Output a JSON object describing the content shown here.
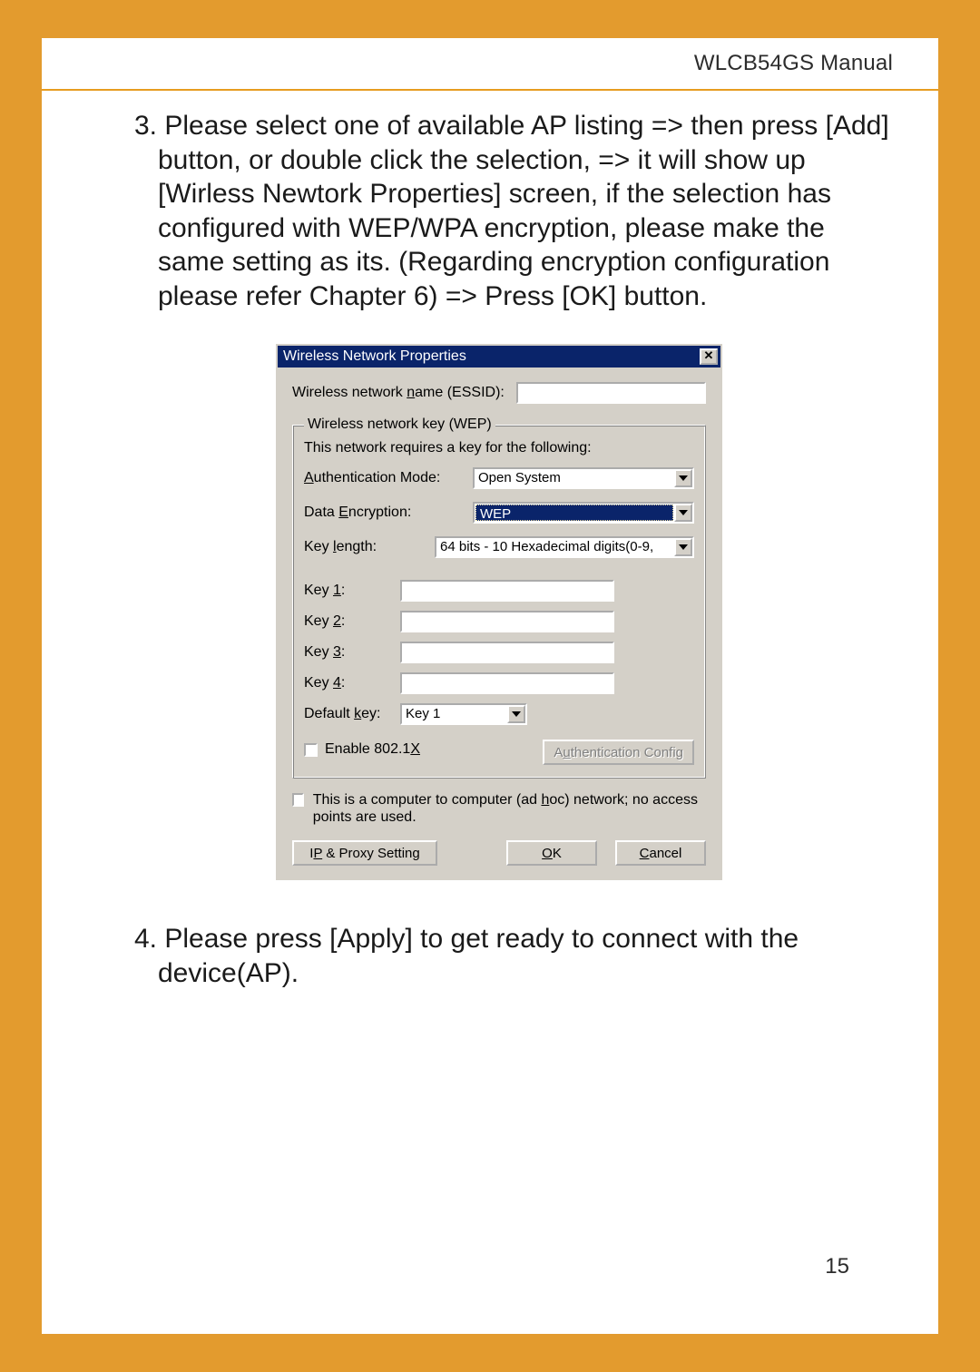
{
  "header": {
    "manual_title": "WLCB54GS Manual"
  },
  "paragraphs": {
    "p3_num": "3. ",
    "p3_text": "Please select one of available AP listing => then press [Add] button, or double click the selection, => it will show up [Wirless Newtork Properties] screen, if the selection has configured with WEP/WPA encryption, please make the same setting as its. (Regarding encryption configuration please refer Chapter 6) => Press [OK] button.",
    "p4_num": "4. ",
    "p4_text": "Please press [Apply] to get ready to connect with the device(AP)."
  },
  "dialog": {
    "title": "Wireless Network Properties",
    "essid_label_pre": "Wireless network ",
    "essid_label_u": "n",
    "essid_label_post": "ame (ESSID):",
    "essid_value": "",
    "wep_legend": "Wireless network key (WEP)",
    "wep_intro": "This network requires a key for the following:",
    "auth_label_pre": "",
    "auth_label_u": "A",
    "auth_label_post": "uthentication Mode:",
    "auth_value": "Open System",
    "enc_label_pre": "Data ",
    "enc_label_u": "E",
    "enc_label_post": "ncryption:",
    "enc_value": "WEP",
    "keylen_label_pre": "Key ",
    "keylen_label_u": "l",
    "keylen_label_post": "ength:",
    "keylen_value": "64 bits - 10 Hexadecimal digits(0-9,",
    "key1_label_pre": "Key ",
    "key1_label_u": "1",
    "key1_label_post": ":",
    "key2_label_pre": "Key ",
    "key2_label_u": "2",
    "key2_label_post": ":",
    "key3_label_pre": "Key ",
    "key3_label_u": "3",
    "key3_label_post": ":",
    "key4_label_pre": "Key ",
    "key4_label_u": "4",
    "key4_label_post": ":",
    "defkey_label_pre": "Default ",
    "defkey_label_u": "k",
    "defkey_label_post": "ey:",
    "defkey_value": "Key 1",
    "enable8021x_pre": "Enable 802.1",
    "enable8021x_u": "X",
    "authconfig_btn_pre": "A",
    "authconfig_btn_u": "u",
    "authconfig_btn_post": "thentication Config",
    "adhoc_pre": "This is a computer to computer (ad ",
    "adhoc_u": "h",
    "adhoc_post": "oc) network; no access points are used.",
    "ipproxy_pre": "I",
    "ipproxy_u": "P",
    "ipproxy_post": " & Proxy Setting",
    "ok_u": "O",
    "ok_post": "K",
    "cancel_u": "C",
    "cancel_post": "ancel"
  },
  "page_number": "15"
}
